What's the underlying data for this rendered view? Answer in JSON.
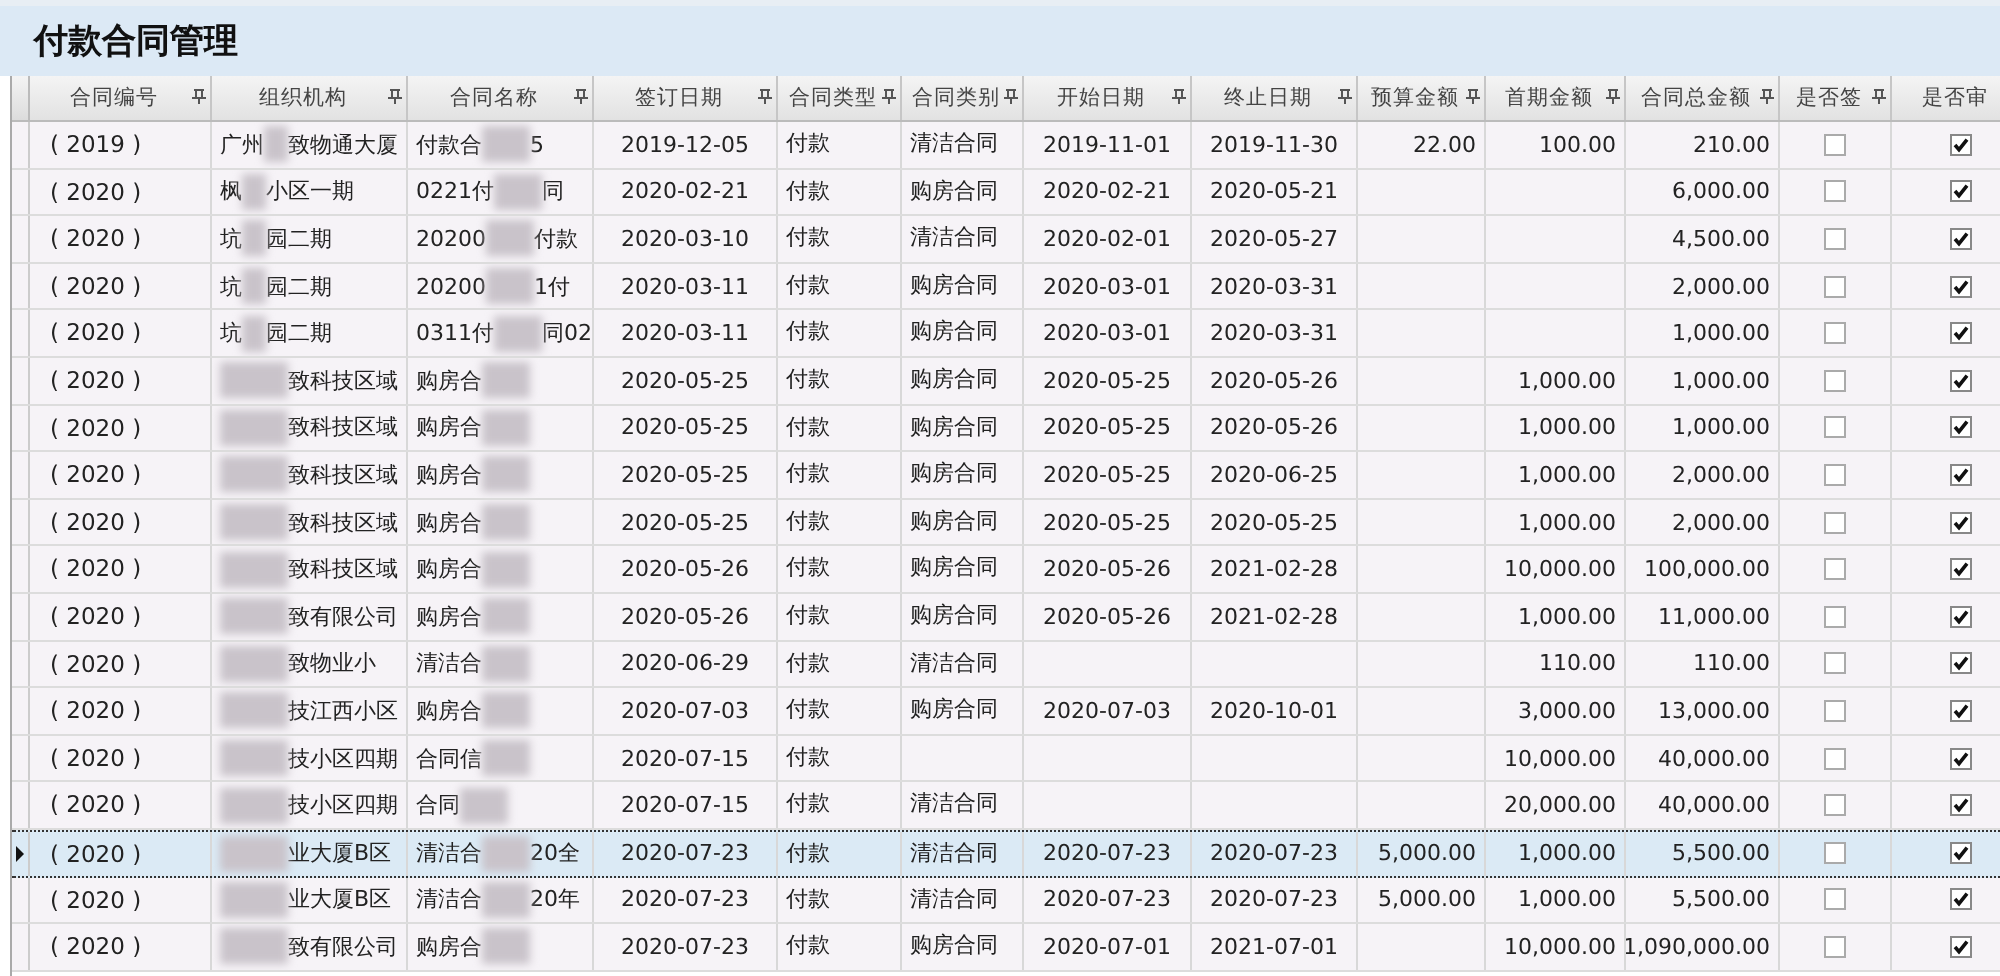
{
  "title": "付款合同管理",
  "table": {
    "columns": [
      "合同编号",
      "组织机构",
      "合同名称",
      "签订日期",
      "合同类型",
      "合同类别",
      "开始日期",
      "终止日期",
      "预算金额",
      "首期金额",
      "合同总金额",
      "是否签",
      "是否审"
    ],
    "rows": [
      {
        "number": "( 2019 )",
        "org": {
          "before": "广州",
          "after": "致物通大厦"
        },
        "name": {
          "before": "付款合",
          "after": "5"
        },
        "signed_date": "2019-12-05",
        "type": "付款",
        "category": "清洁合同",
        "start": "2019-11-01",
        "end": "2019-11-30",
        "budget": "22.00",
        "first": "100.00",
        "total": "210.00",
        "is_signed": false,
        "is_reviewed": true,
        "selected": false
      },
      {
        "number": "( 2020 )",
        "org": {
          "before": "枫",
          "after": "小区一期"
        },
        "name": {
          "before": "0221付",
          "after": "同"
        },
        "signed_date": "2020-02-21",
        "type": "付款",
        "category": "购房合同",
        "start": "2020-02-21",
        "end": "2020-05-21",
        "total": "6,000.00",
        "is_signed": false,
        "is_reviewed": true,
        "selected": false
      },
      {
        "number": "( 2020 )",
        "org": {
          "before": "坑",
          "after": "园二期"
        },
        "name": {
          "before": "20200",
          "after": "付款"
        },
        "signed_date": "2020-03-10",
        "type": "付款",
        "category": "清洁合同",
        "start": "2020-02-01",
        "end": "2020-05-27",
        "total": "4,500.00",
        "is_signed": false,
        "is_reviewed": true,
        "selected": false
      },
      {
        "number": "( 2020 )",
        "org": {
          "before": "坑",
          "after": "园二期"
        },
        "name": {
          "before": "20200",
          "after": "1付"
        },
        "signed_date": "2020-03-11",
        "type": "付款",
        "category": "购房合同",
        "start": "2020-03-01",
        "end": "2020-03-31",
        "total": "2,000.00",
        "is_signed": false,
        "is_reviewed": true,
        "selected": false
      },
      {
        "number": "( 2020 )",
        "org": {
          "before": "坑",
          "after": "园二期"
        },
        "name": {
          "before": "0311付",
          "after": "同02"
        },
        "signed_date": "2020-03-11",
        "type": "付款",
        "category": "购房合同",
        "start": "2020-03-01",
        "end": "2020-03-31",
        "total": "1,000.00",
        "is_signed": false,
        "is_reviewed": true,
        "selected": false
      },
      {
        "number": "( 2020 )",
        "org": {
          "after": "致科技区域"
        },
        "name": {
          "before": "购房合"
        },
        "signed_date": "2020-05-25",
        "type": "付款",
        "category": "购房合同",
        "start": "2020-05-25",
        "end": "2020-05-26",
        "first": "1,000.00",
        "total": "1,000.00",
        "is_signed": false,
        "is_reviewed": true,
        "selected": false
      },
      {
        "number": "( 2020 )",
        "org": {
          "after": "致科技区域"
        },
        "name": {
          "before": "购房合"
        },
        "signed_date": "2020-05-25",
        "type": "付款",
        "category": "购房合同",
        "start": "2020-05-25",
        "end": "2020-05-26",
        "first": "1,000.00",
        "total": "1,000.00",
        "is_signed": false,
        "is_reviewed": true,
        "selected": false
      },
      {
        "number": "( 2020 )",
        "org": {
          "after": "致科技区域"
        },
        "name": {
          "before": "购房合"
        },
        "signed_date": "2020-05-25",
        "type": "付款",
        "category": "购房合同",
        "start": "2020-05-25",
        "end": "2020-06-25",
        "first": "1,000.00",
        "total": "2,000.00",
        "is_signed": false,
        "is_reviewed": true,
        "selected": false
      },
      {
        "number": "( 2020 )",
        "org": {
          "after": "致科技区域"
        },
        "name": {
          "before": "购房合"
        },
        "signed_date": "2020-05-25",
        "type": "付款",
        "category": "购房合同",
        "start": "2020-05-25",
        "end": "2020-05-25",
        "first": "1,000.00",
        "total": "2,000.00",
        "is_signed": false,
        "is_reviewed": true,
        "selected": false
      },
      {
        "number": "( 2020 )",
        "org": {
          "after": "致科技区域"
        },
        "name": {
          "before": "购房合"
        },
        "signed_date": "2020-05-26",
        "type": "付款",
        "category": "购房合同",
        "start": "2020-05-26",
        "end": "2021-02-28",
        "first": "10,000.00",
        "total": "100,000.00",
        "is_signed": false,
        "is_reviewed": true,
        "selected": false
      },
      {
        "number": "( 2020 )",
        "org": {
          "after": "致有限公司"
        },
        "name": {
          "before": "购房合"
        },
        "signed_date": "2020-05-26",
        "type": "付款",
        "category": "购房合同",
        "start": "2020-05-26",
        "end": "2021-02-28",
        "first": "1,000.00",
        "total": "11,000.00",
        "is_signed": false,
        "is_reviewed": true,
        "selected": false
      },
      {
        "number": "( 2020 )",
        "org": {
          "after": "致物业小"
        },
        "name": {
          "before": "清洁合"
        },
        "signed_date": "2020-06-29",
        "type": "付款",
        "category": "清洁合同",
        "first": "110.00",
        "total": "110.00",
        "is_signed": false,
        "is_reviewed": true,
        "selected": false
      },
      {
        "number": "( 2020 )",
        "org": {
          "after": "技江西小区"
        },
        "name": {
          "before": "购房合"
        },
        "signed_date": "2020-07-03",
        "type": "付款",
        "category": "购房合同",
        "start": "2020-07-03",
        "end": "2020-10-01",
        "first": "3,000.00",
        "total": "13,000.00",
        "is_signed": false,
        "is_reviewed": true,
        "selected": false
      },
      {
        "number": "( 2020 )",
        "org": {
          "after": "技小区四期"
        },
        "name": {
          "before": "合同信"
        },
        "signed_date": "2020-07-15",
        "type": "付款",
        "first": "10,000.00",
        "total": "40,000.00",
        "is_signed": false,
        "is_reviewed": true,
        "selected": false
      },
      {
        "number": "( 2020 )",
        "org": {
          "after": "技小区四期"
        },
        "name": {
          "before": "合同"
        },
        "signed_date": "2020-07-15",
        "type": "付款",
        "category": "清洁合同",
        "first": "20,000.00",
        "total": "40,000.00",
        "is_signed": false,
        "is_reviewed": true,
        "selected": false
      },
      {
        "number": "( 2020 )",
        "org": {
          "after": "业大厦B区"
        },
        "name": {
          "before": "清洁合",
          "after": "20全"
        },
        "signed_date": "2020-07-23",
        "type": "付款",
        "category": "清洁合同",
        "start": "2020-07-23",
        "end": "2020-07-23",
        "budget": "5,000.00",
        "first": "1,000.00",
        "total": "5,500.00",
        "is_signed": false,
        "is_reviewed": true,
        "selected": true
      },
      {
        "number": "( 2020 )",
        "org": {
          "after": "业大厦B区"
        },
        "name": {
          "before": "清洁合",
          "after": "20年"
        },
        "signed_date": "2020-07-23",
        "type": "付款",
        "category": "清洁合同",
        "start": "2020-07-23",
        "end": "2020-07-23",
        "budget": "5,000.00",
        "first": "1,000.00",
        "total": "5,500.00",
        "is_signed": false,
        "is_reviewed": true,
        "selected": false
      },
      {
        "number": "( 2020 )",
        "org": {
          "after": "致有限公司"
        },
        "name": {
          "before": "购房合"
        },
        "signed_date": "2020-07-23",
        "type": "付款",
        "category": "购房合同",
        "start": "2020-07-01",
        "end": "2021-07-01",
        "first": "10,000.00",
        "total": "1,090,000.00",
        "is_signed": false,
        "is_reviewed": true,
        "selected": false
      }
    ]
  }
}
